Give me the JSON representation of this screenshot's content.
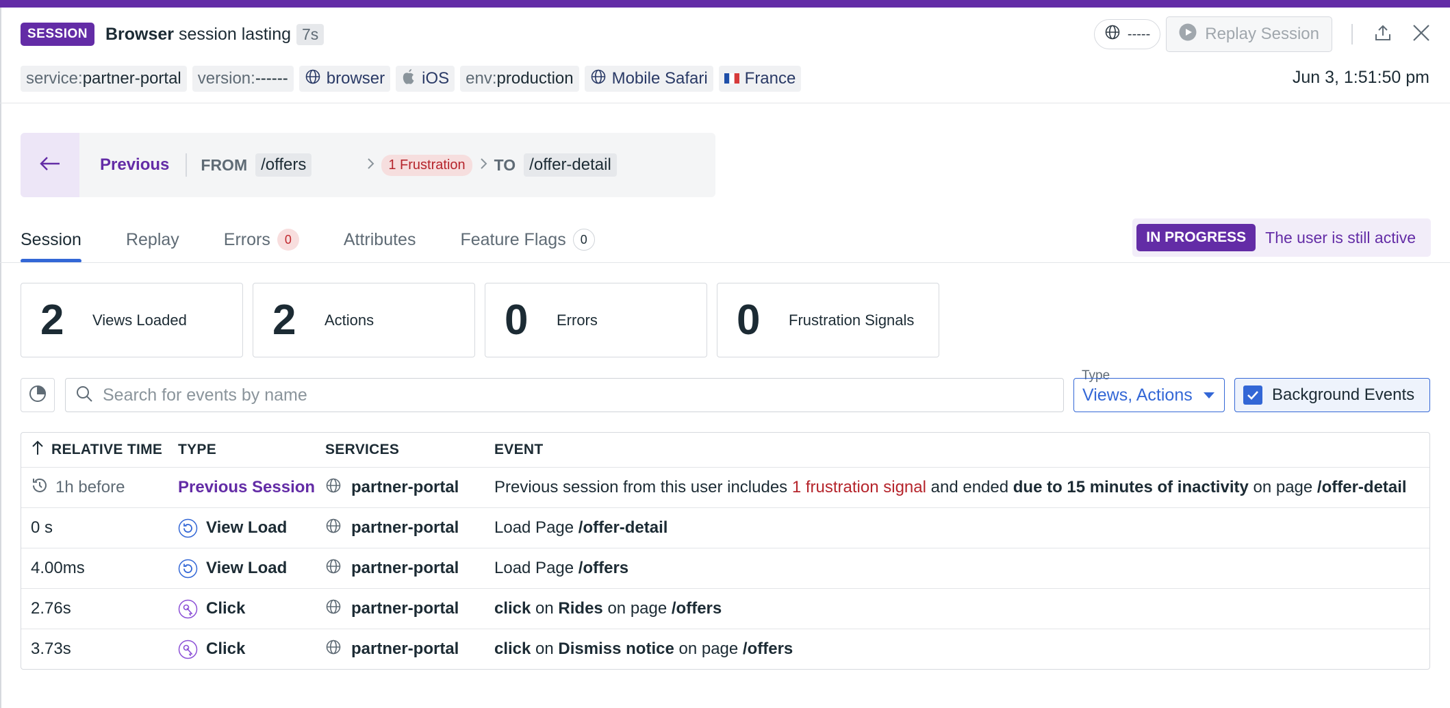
{
  "header": {
    "badge": "SESSION",
    "title_bold": "Browser",
    "title_rest": "session lasting",
    "duration": "7s",
    "version_pill": "-----",
    "replay_label": "Replay Session",
    "timestamp": "Jun 3, 1:51:50 pm"
  },
  "tags": [
    {
      "key": "service:",
      "value": "partner-portal",
      "icon": "none"
    },
    {
      "key": "version:",
      "value": "------",
      "icon": "none"
    },
    {
      "key": "",
      "value": "browser",
      "icon": "globe-icon"
    },
    {
      "key": "",
      "value": "iOS",
      "icon": "apple-icon"
    },
    {
      "key": "env:",
      "value": "production",
      "icon": "none"
    },
    {
      "key": "",
      "value": "Mobile Safari",
      "icon": "globe-icon"
    },
    {
      "key": "",
      "value": "France",
      "icon": "france-flag-icon"
    }
  ],
  "nav": {
    "previous": "Previous",
    "from_label": "FROM",
    "from_path": "/offers",
    "frustration": "1 Frustration",
    "to_label": "TO",
    "to_path": "/offer-detail"
  },
  "tabs": [
    {
      "label": "Session",
      "active": true
    },
    {
      "label": "Replay"
    },
    {
      "label": "Errors",
      "count": "0"
    },
    {
      "label": "Attributes"
    },
    {
      "label": "Feature Flags",
      "count": "0"
    }
  ],
  "status": {
    "badge": "IN PROGRESS",
    "text": "The user is still active"
  },
  "stats": [
    {
      "num": "2",
      "label": "Views Loaded"
    },
    {
      "num": "2",
      "label": "Actions"
    },
    {
      "num": "0",
      "label": "Errors"
    },
    {
      "num": "0",
      "label": "Frustration Signals"
    }
  ],
  "filters": {
    "search_placeholder": "Search for events by name",
    "type_label": "Type",
    "type_value": "Views, Actions",
    "background_events": "Background Events"
  },
  "table": {
    "headers": [
      "RELATIVE TIME",
      "TYPE",
      "SERVICES",
      "EVENT"
    ],
    "rows": [
      {
        "time": "1h before",
        "type": "Previous Session",
        "service": "partner-portal",
        "event": [
          {
            "t": "Previous session from this user includes ",
            "s": "normal"
          },
          {
            "t": "1 frustration signal",
            "s": "red"
          },
          {
            "t": " and ended ",
            "s": "normal"
          },
          {
            "t": "due to 15 minutes of inactivity",
            "s": "bold"
          },
          {
            "t": " on page ",
            "s": "normal"
          },
          {
            "t": "/offer-detail",
            "s": "bold"
          }
        ]
      },
      {
        "time": "0 s",
        "type": "View Load",
        "service": "partner-portal",
        "event": [
          {
            "t": "Load Page ",
            "s": "normal"
          },
          {
            "t": "/offer-detail",
            "s": "bold"
          }
        ]
      },
      {
        "time": "4.00ms",
        "type": "View Load",
        "service": "partner-portal",
        "event": [
          {
            "t": "Load Page ",
            "s": "normal"
          },
          {
            "t": "/offers",
            "s": "bold"
          }
        ]
      },
      {
        "time": "2.76s",
        "type": "Click",
        "service": "partner-portal",
        "event": [
          {
            "t": "click",
            "s": "bold"
          },
          {
            "t": " on ",
            "s": "normal"
          },
          {
            "t": "Rides",
            "s": "bold"
          },
          {
            "t": " on page ",
            "s": "normal"
          },
          {
            "t": "/offers",
            "s": "bold"
          }
        ]
      },
      {
        "time": "3.73s",
        "type": "Click",
        "service": "partner-portal",
        "event": [
          {
            "t": "click",
            "s": "bold"
          },
          {
            "t": " on ",
            "s": "normal"
          },
          {
            "t": "Dismiss notice",
            "s": "bold"
          },
          {
            "t": " on page ",
            "s": "normal"
          },
          {
            "t": "/offers",
            "s": "bold"
          }
        ]
      }
    ]
  },
  "colors": {
    "brand": "#632ca6",
    "accent": "#3367d6",
    "danger": "#b5242b"
  }
}
